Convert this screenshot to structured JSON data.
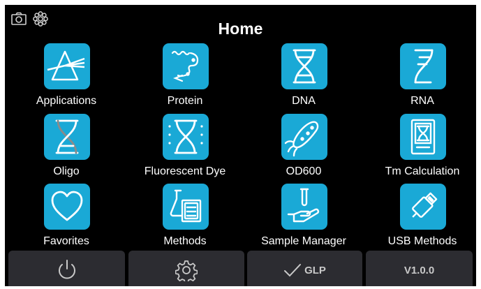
{
  "header": {
    "title": "Home",
    "left_icons": [
      "camera-icon",
      "gear-flower-icon"
    ]
  },
  "tiles": [
    {
      "label": "Applications",
      "icon": "prism-icon"
    },
    {
      "label": "Protein",
      "icon": "protein-chain-icon"
    },
    {
      "label": "DNA",
      "icon": "dna-helix-icon"
    },
    {
      "label": "RNA",
      "icon": "rna-strand-icon"
    },
    {
      "label": "Oligo",
      "icon": "oligo-helix-icon"
    },
    {
      "label": "Fluorescent Dye",
      "icon": "fluorescent-helix-icon"
    },
    {
      "label": "OD600",
      "icon": "bacteria-icon"
    },
    {
      "label": "Tm Calculation",
      "icon": "tm-calculation-icon"
    },
    {
      "label": "Favorites",
      "icon": "heart-icon"
    },
    {
      "label": "Methods",
      "icon": "flask-documents-icon"
    },
    {
      "label": "Sample Manager",
      "icon": "hand-tube-icon"
    },
    {
      "label": "USB Methods",
      "icon": "usb-drive-icon"
    }
  ],
  "bottom_bar": {
    "power": {
      "icon": "power-icon"
    },
    "settings": {
      "icon": "gear-icon"
    },
    "glp": {
      "label": "GLP",
      "icon": "checkmark-icon"
    },
    "version": {
      "label": "V1.0.0"
    }
  },
  "colors": {
    "background": "#000000",
    "tile_icon_bg": "#1aa9d6",
    "bottom_button_bg": "#2c2c31",
    "text": "#ffffff"
  }
}
